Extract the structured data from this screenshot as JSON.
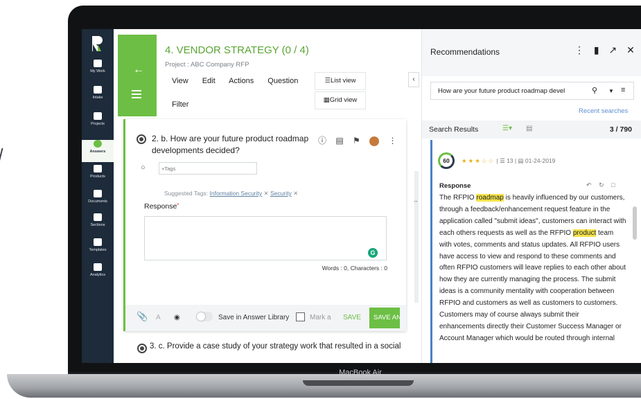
{
  "device_label": "MacBook Air",
  "nav": {
    "items": [
      {
        "label": "My Work",
        "icon": "dashboard-icon"
      },
      {
        "label": "Intake",
        "icon": "intake-icon"
      },
      {
        "label": "Projects",
        "icon": "projects-icon"
      },
      {
        "label": "Answers",
        "icon": "answers-icon",
        "active": true
      },
      {
        "label": "Products",
        "icon": "products-icon"
      },
      {
        "label": "Documents",
        "icon": "documents-icon"
      },
      {
        "label": "Sections",
        "icon": "sections-icon"
      },
      {
        "label": "Templates",
        "icon": "templates-icon"
      },
      {
        "label": "Analytics",
        "icon": "analytics-icon"
      }
    ]
  },
  "header": {
    "title": "4. VENDOR STRATEGY  (0 / 4)",
    "project": "Project : ABC Company RFP",
    "menu": [
      "View",
      "Edit",
      "Actions",
      "Question"
    ],
    "filter": "Filter",
    "list_view": "List view",
    "grid_view": "Grid view"
  },
  "question": {
    "text": "2. b. How are your future product roadmap developments decided?",
    "tags_placeholder": "+Tags",
    "suggested_label": "Suggested Tags:",
    "suggested_tags": [
      "Information Security",
      "Security"
    ],
    "response_label": "Response",
    "words": "Words : 0, Characters : 0",
    "save_library": "Save in Answer Library",
    "mark": "Mark a",
    "save": "SAVE",
    "save_another": "SAVE AND",
    "next_question": "3. c. Provide a case study of your strategy work that resulted in a social"
  },
  "panel": {
    "title": "Recommendations",
    "search_query": "How are your future product roadmap devel",
    "recent": "Recent searches",
    "results_label": "Search Results",
    "results_count": "3 / 790",
    "result": {
      "score": "60",
      "rating": 3,
      "copies": "13",
      "date": "01-24-2019",
      "label": "Response",
      "text_parts": [
        {
          "t": "The RFPIO ",
          "hl": false
        },
        {
          "t": "roadmap",
          "hl": true
        },
        {
          "t": " is heavily influenced by our customers, through a feedback/enhancement request feature in the application called \"submit ideas\", customers can interact with each others requests as well as the RFPIO ",
          "hl": false
        },
        {
          "t": "product",
          "hl": true
        },
        {
          "t": " team with votes, comments and status updates. All RFPIO users have access to view and respond to these comments and often RFPIO customers will leave replies to each other about how they are currently managing the process. The submit ideas is a community mentality with cooperation between RFPIO and customers as well as customers to customers. Customers may of course always submit their enhancements directly their Customer Success Manager or Account Manager which would be routed through internal",
          "hl": false
        }
      ]
    }
  },
  "colors": {
    "brand_green": "#6cbf44",
    "nav_bg": "#1d2b3a",
    "link_blue": "#5d8fd1",
    "highlight": "#f4e34a"
  }
}
